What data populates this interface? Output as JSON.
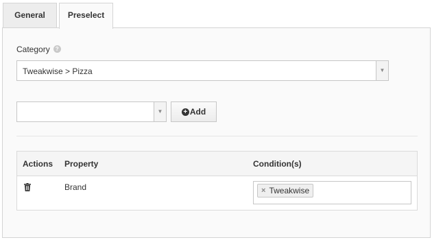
{
  "tabs": [
    {
      "label": "General",
      "active": false
    },
    {
      "label": "Preselect",
      "active": true
    }
  ],
  "category": {
    "label": "Category",
    "help_icon": "question-icon",
    "selected": "Tweakwise > Pizza"
  },
  "property_select": {
    "selected": ""
  },
  "add_button": {
    "label": "Add",
    "icon": "plus-circle-icon"
  },
  "table": {
    "headers": [
      "Actions",
      "Property",
      "Condition(s)"
    ],
    "rows": [
      {
        "action_icon": "trash-icon",
        "property": "Brand",
        "conditions": [
          "Tweakwise"
        ]
      }
    ]
  },
  "colors": {
    "panel_bg": "#fafafa",
    "border": "#d4d4d4",
    "header_bg": "#f5f5f5"
  }
}
